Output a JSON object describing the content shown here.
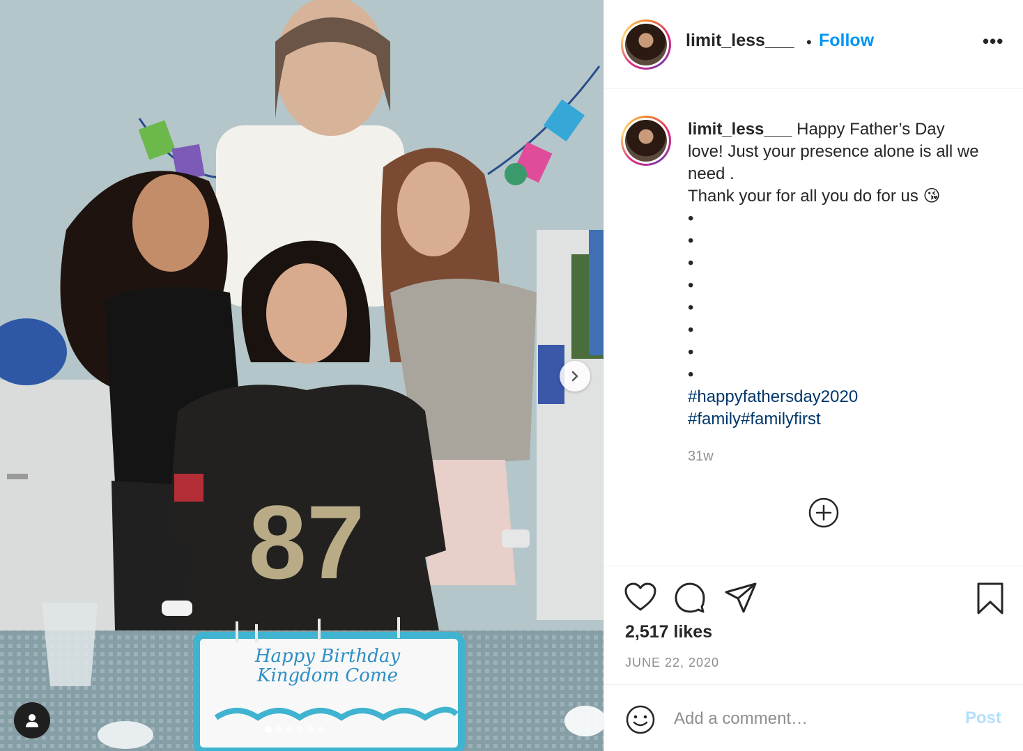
{
  "post": {
    "username": "limit_less___",
    "separator": "•",
    "follow_label": "Follow",
    "more_label": "•••",
    "caption": {
      "lines": [
        "Happy Father’s Day",
        "love! Just your presence alone is all we",
        "need .",
        "Thank your for all you do for us 😘"
      ],
      "dots": [
        "•",
        "•",
        "•",
        "•",
        "•",
        "•",
        "•",
        "•"
      ],
      "hashtags": [
        "#happyfathersday2020",
        "#family",
        "#familyfirst"
      ]
    },
    "time_ago": "31w",
    "likes": "2,517 likes",
    "date": "JUNE 22, 2020",
    "comment": {
      "placeholder": "Add a comment…",
      "post_label": "Post"
    }
  },
  "photo": {
    "jersey_number": "87",
    "cake_text_line1": "Happy Birthday",
    "cake_text_line2": "Kingdom Come",
    "carousel_dots": 6,
    "active_dot": 0
  },
  "colors": {
    "follow_blue": "#0095f6",
    "hashtag_blue": "#00376b",
    "post_disabled": "#b2dffc",
    "muted_text": "#8e8e8e"
  }
}
